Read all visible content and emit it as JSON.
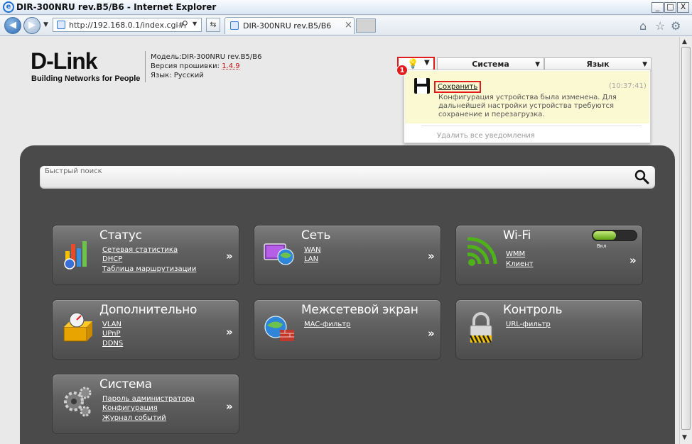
{
  "window": {
    "title": "DIR-300NRU rev.B5/B6 - Internet Explorer",
    "minimize": "_",
    "maximize": "□",
    "close": "X"
  },
  "browser": {
    "address": "http://192.168.0.1/index.cgi#",
    "tab_title": "DIR-300NRU rev.B5/B6",
    "tab_close": "×"
  },
  "device": {
    "logo": "D-Link",
    "slogan": "Building Networks for People",
    "model_line": "Модель:DIR-300NRU rev.B5/B6",
    "firmware_label": "Версия прошивки: ",
    "firmware_version": "1.4.9",
    "language_line": "Язык: Русский"
  },
  "topmenu": {
    "system": "Система",
    "language": "Язык",
    "badge_count": "1"
  },
  "notification": {
    "action": "Сохранить",
    "time": "(10:37:41)",
    "message": "Конфигурация устройства была изменена. Для дальнейшей настройки устройства требуются сохранение и перезагрузка.",
    "clear_all": "Удалить все уведомления"
  },
  "search": {
    "placeholder": "Быстрый поиск"
  },
  "tiles": [
    {
      "title": "Статус",
      "links": [
        "Сетевая статистика",
        "DHCP",
        "Таблица маршрутизации"
      ],
      "icon": "bar-chart-icon"
    },
    {
      "title": "Сеть",
      "links": [
        "WAN",
        "LAN"
      ],
      "icon": "network-globe-icon"
    },
    {
      "title": "Wi-Fi",
      "links": [
        "WMM",
        "Клиент"
      ],
      "icon": "wifi-icon",
      "toggle_label": "Вкл",
      "toggle_on": true
    },
    {
      "title": "Дополнительно",
      "links": [
        "VLAN",
        "UPnP",
        "DDNS"
      ],
      "icon": "box-gauge-icon"
    },
    {
      "title": "Межсетевой экран",
      "links": [
        "MAC-фильтр"
      ],
      "icon": "firewall-globe-icon"
    },
    {
      "title": "Контроль",
      "links": [
        "URL-фильтр"
      ],
      "icon": "padlock-icon"
    },
    {
      "title": "Система",
      "links": [
        "Пароль администратора",
        "Конфигурация",
        "Журнал событий"
      ],
      "icon": "gears-icon"
    }
  ],
  "more_glyph": "»"
}
